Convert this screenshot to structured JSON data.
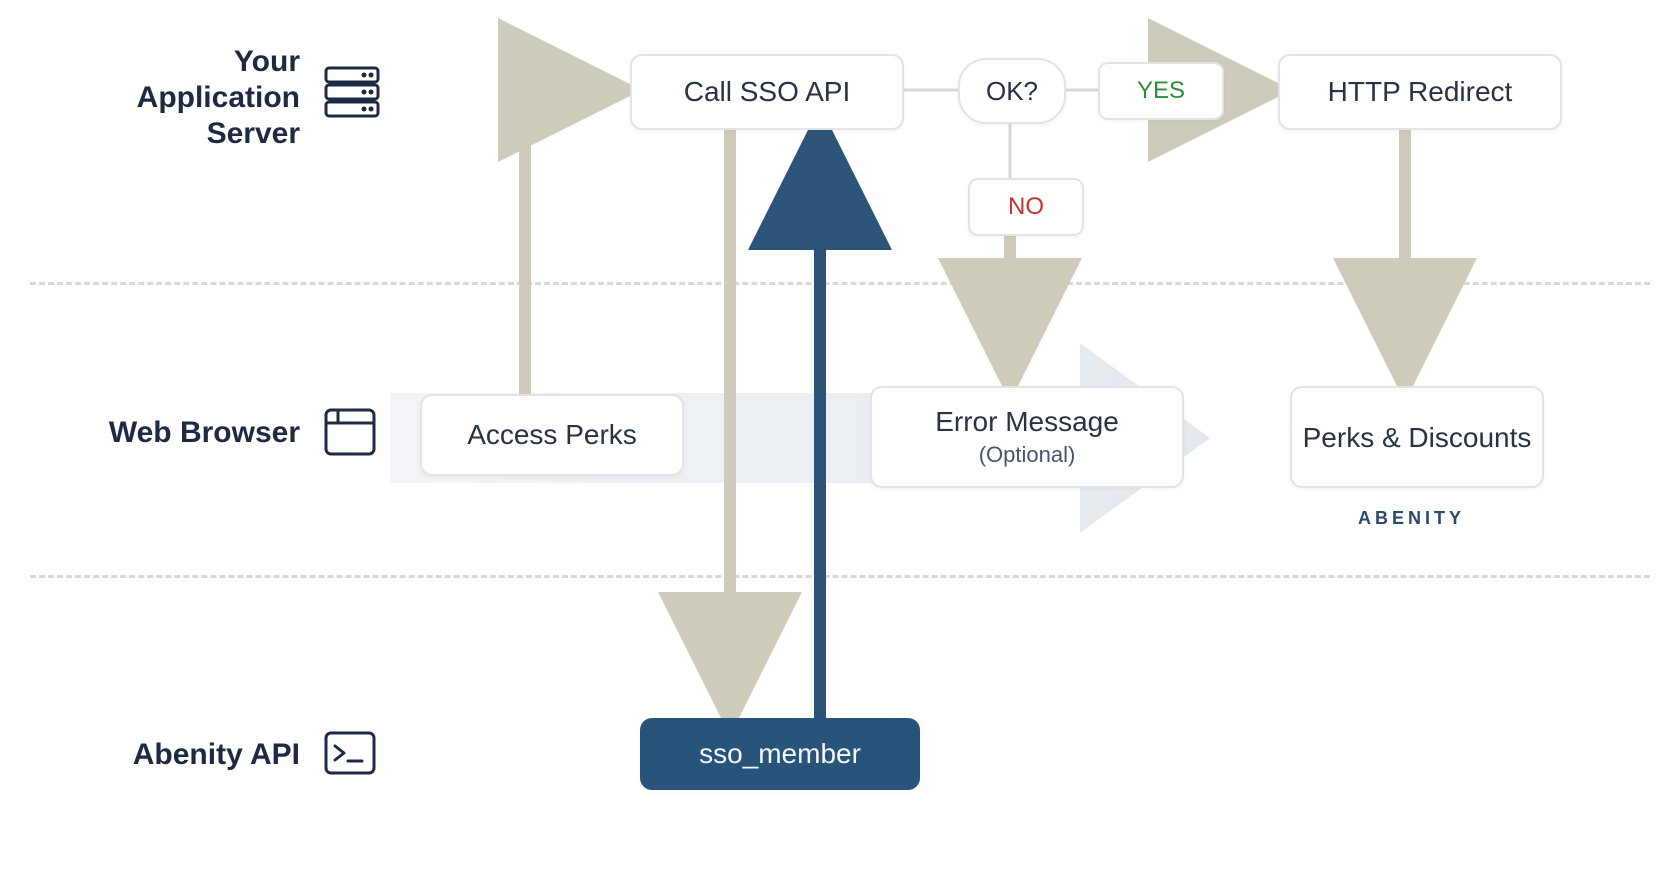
{
  "lanes": {
    "app_server": {
      "line1": "Your",
      "line2": "Application",
      "line3": "Server"
    },
    "browser": {
      "label": "Web Browser"
    },
    "api": {
      "label": "Abenity API"
    }
  },
  "nodes": {
    "access_perks": "Access Perks",
    "call_sso": "Call SSO API",
    "ok": "OK?",
    "yes": "YES",
    "no": "NO",
    "http_redirect": "HTTP Redirect",
    "error_msg": "Error Message",
    "error_sub": "(Optional)",
    "perks": "Perks & Discounts",
    "sso_member": "sso_member"
  },
  "brand_tag": "ABENITY",
  "colors": {
    "line_light": "#cfcbbd",
    "line_dark": "#2b5478",
    "box_border": "#e4e4e6",
    "text": "#283245",
    "bg_arrow": "#edf0f4"
  }
}
